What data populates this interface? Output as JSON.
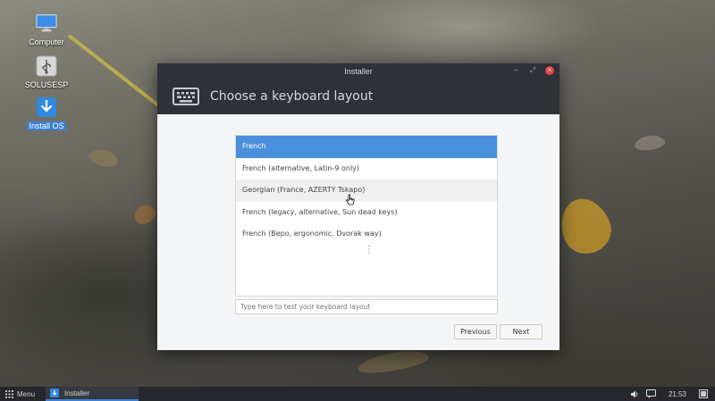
{
  "desktop": {
    "icons": [
      {
        "label": "Computer",
        "icon": "monitor-icon"
      },
      {
        "label": "SOLUSESP",
        "icon": "usb-drive-icon"
      },
      {
        "label": "Install OS",
        "icon": "install-download-icon"
      }
    ]
  },
  "window": {
    "title": "Installer",
    "controls": {
      "minimize": "–",
      "maximize": "⤢",
      "close": "×"
    },
    "header_title": "Choose a keyboard layout",
    "header_icon": "keyboard-icon",
    "layouts": [
      "French",
      "French (alternative, Latin-9 only)",
      "Georgian (France, AZERTY Tskapo)",
      "French (legacy, alternative, Sun dead keys)",
      "French (Bepo, ergonomic, Dvorak way)"
    ],
    "selected_index": 0,
    "hover_index": 2,
    "more_indicator": "⋮",
    "test_input": {
      "placeholder": "Type here to test your keyboard layout",
      "value": ""
    },
    "buttons": {
      "previous": "Previous",
      "next": "Next"
    }
  },
  "taskbar": {
    "menu_label": "Menu",
    "task_label": "Installer",
    "clock": "21:53"
  },
  "colors": {
    "accent": "#4a8fdb",
    "header_bg": "#2e3138",
    "close_red": "#e0454a"
  }
}
